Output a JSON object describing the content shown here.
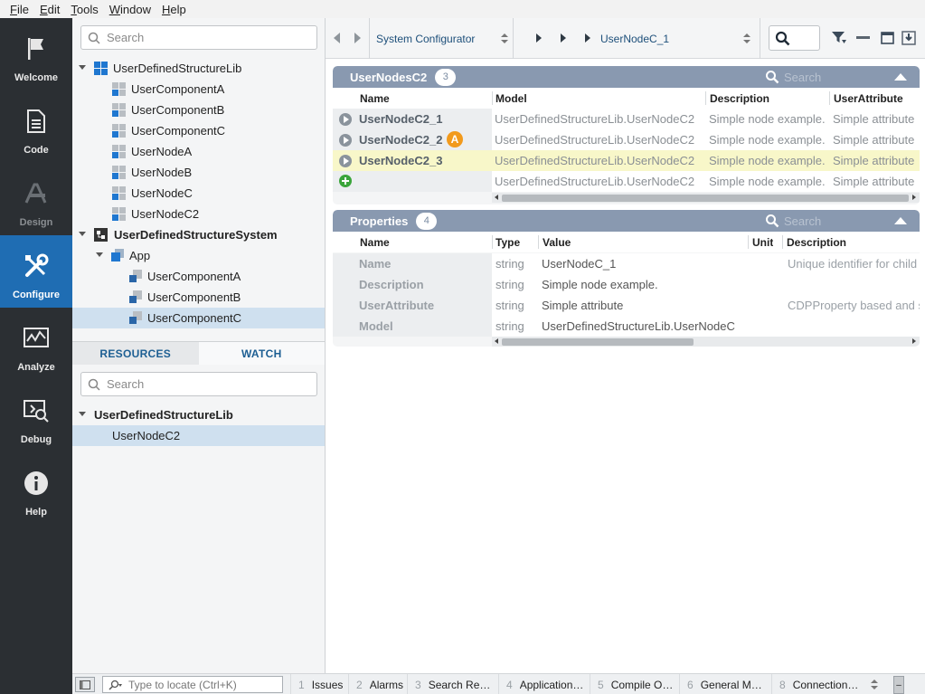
{
  "menu": [
    {
      "u": "F",
      "rest": "ile"
    },
    {
      "u": "E",
      "rest": "dit"
    },
    {
      "u": "T",
      "rest": "ools"
    },
    {
      "u": "W",
      "rest": "indow"
    },
    {
      "u": "H",
      "rest": "elp"
    }
  ],
  "rail": {
    "welcome": "Welcome",
    "code": "Code",
    "design": "Design",
    "configure": "Configure",
    "analyze": "Analyze",
    "debug": "Debug",
    "help": "Help"
  },
  "project": {
    "search_placeholder": "Search",
    "lib_name": "UserDefinedStructureLib",
    "lib_items": [
      "UserComponentA",
      "UserComponentB",
      "UserComponentC",
      "UserNodeA",
      "UserNodeB",
      "UserNodeC",
      "UserNodeC2"
    ],
    "system_name": "UserDefinedStructureSystem",
    "app_name": "App",
    "app_items": [
      "UserComponentA",
      "UserComponentB",
      "UserComponentC"
    ]
  },
  "bottom_tabs": {
    "resources": "RESOURCES",
    "watch": "WATCH"
  },
  "resources": {
    "search_placeholder": "Search",
    "lib_name": "UserDefinedStructureLib",
    "item": "UserNodeC2"
  },
  "toolbar": {
    "configurator": "System Configurator",
    "breadcrumb": "UserNodeC_1"
  },
  "nodes_panel": {
    "title": "UserNodesC2",
    "count": "3",
    "search_placeholder": "Search",
    "columns": {
      "name": "Name",
      "model": "Model",
      "description": "Description",
      "attr": "UserAttribute"
    },
    "rows": [
      {
        "name": "UserNodeC2_1",
        "model": "UserDefinedStructureLib.UserNodeC2",
        "description": "Simple node example.",
        "attr": "Simple attribute"
      },
      {
        "name": "UserNodeC2_2",
        "badge": "A",
        "model": "UserDefinedStructureLib.UserNodeC2",
        "description": "Simple node example.",
        "attr": "Simple attribute"
      },
      {
        "name": "UserNodeC2_3",
        "model": "UserDefinedStructureLib.UserNodeC2",
        "description": "Simple node example.",
        "attr": "Simple attribute"
      },
      {
        "name": "",
        "model": "UserDefinedStructureLib.UserNodeC2",
        "description": "Simple node example.",
        "attr": "Simple attribute"
      }
    ]
  },
  "properties_panel": {
    "title": "Properties",
    "count": "4",
    "search_placeholder": "Search",
    "columns": {
      "name": "Name",
      "type": "Type",
      "value": "Value",
      "unit": "Unit",
      "description": "Description"
    },
    "rows": [
      {
        "name": "Name",
        "type": "string",
        "value": "UserNodeC_1",
        "unit": "",
        "description": "Unique identifier for child"
      },
      {
        "name": "Description",
        "type": "string",
        "value": "Simple node example.",
        "unit": "",
        "description": ""
      },
      {
        "name": "UserAttribute",
        "type": "string",
        "value": "Simple attribute",
        "unit": "",
        "description": "CDPProperty based and s"
      },
      {
        "name": "Model",
        "type": "string",
        "value": "UserDefinedStructureLib.UserNodeC",
        "unit": "",
        "description": ""
      }
    ]
  },
  "statusbar": {
    "locate_placeholder": "Type to locate (Ctrl+K)",
    "tabs": [
      {
        "n": "1",
        "label": "Issues"
      },
      {
        "n": "2",
        "label": "Alarms"
      },
      {
        "n": "3",
        "label": "Search Re…"
      },
      {
        "n": "4",
        "label": "Application…"
      },
      {
        "n": "5",
        "label": "Compile O…"
      },
      {
        "n": "6",
        "label": "General M…"
      },
      {
        "n": "8",
        "label": "Connection…"
      }
    ]
  },
  "colors": {
    "rail_bg": "#2b2f33",
    "rail_active": "#1f6db3",
    "panel_header": "#8999b0",
    "highlight_row": "#f8f7c9",
    "badge_orange": "#f29a1c",
    "add_green": "#3aa53a"
  }
}
